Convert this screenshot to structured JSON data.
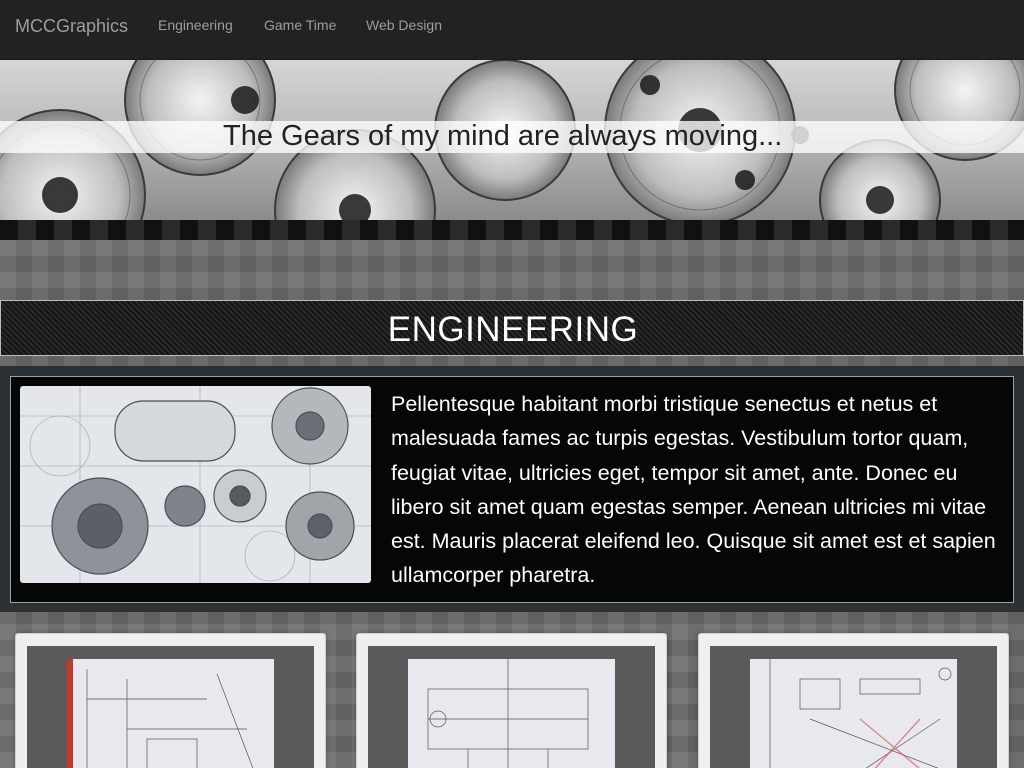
{
  "navbar": {
    "brand": "MCCGraphics",
    "links": [
      "Engineering",
      "Game Time",
      "Web Design"
    ]
  },
  "hero": {
    "tagline": "The Gears of my mind are always moving..."
  },
  "section": {
    "title": "ENGINEERING"
  },
  "feature": {
    "image_icon": "gears-blueprint-image",
    "text": "Pellentesque habitant morbi tristique senectus et netus et malesuada fames ac turpis egestas. Vestibulum tortor quam, feugiat vitae, ultricies eget, tempor sit amet, ante. Donec eu libero sit amet quam egestas semper. Aenean ultricies mi vitae est. Mauris placerat eleifend leo. Quisque sit amet est et sapien ullamcorper pharetra."
  },
  "thumbnails": [
    {
      "icon": "blueprint-drawing-1"
    },
    {
      "icon": "blueprint-drawing-2"
    },
    {
      "icon": "blueprint-drawing-3"
    }
  ],
  "colors": {
    "navbar_bg": "#222222",
    "nav_text": "#9d9d9d",
    "section_bg": "#1b1b1b",
    "panel_bg": "#060606",
    "panel_wrap_bg": "#2b3134",
    "page_bg": "#6a6a6a"
  }
}
